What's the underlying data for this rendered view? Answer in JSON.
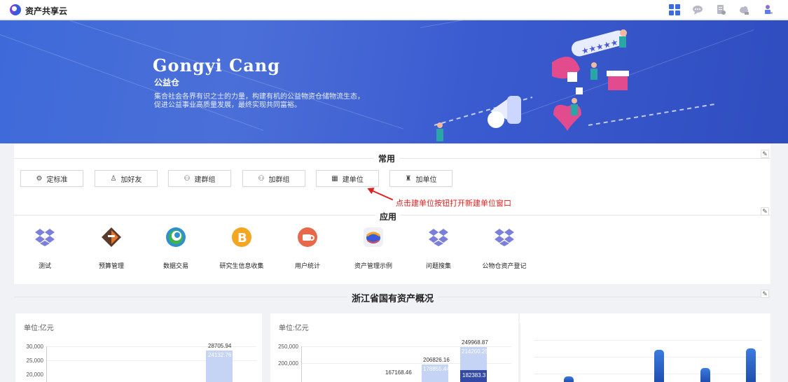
{
  "app": {
    "title": "资产共享云"
  },
  "topbar": {
    "icons": [
      "apps-grid-icon",
      "chat-icon",
      "document-icon",
      "cloud-icon",
      "user-tree-icon"
    ]
  },
  "banner": {
    "title": "Gongyi Cang",
    "subtitle": "公益仓",
    "desc_line1": "集合社会各界有识之士的力量，构建有机的公益物资仓储物流生态，",
    "desc_line2": "促进公益事业高质量发展，最终实现共同富裕。"
  },
  "common": {
    "title": "常用",
    "buttons": [
      {
        "label": "定标准",
        "icon": "gear-icon",
        "glyph": "⚙"
      },
      {
        "label": "加好友",
        "icon": "user-icon",
        "glyph": "♙"
      },
      {
        "label": "建群组",
        "icon": "group-icon",
        "glyph": "⚇"
      },
      {
        "label": "加群组",
        "icon": "group-add-icon",
        "glyph": "⚇"
      },
      {
        "label": "建单位",
        "icon": "building-icon",
        "glyph": "▦"
      },
      {
        "label": "加单位",
        "icon": "org-icon",
        "glyph": "♜"
      }
    ],
    "annotation": "点击建单位按钮打开新建单位窗口"
  },
  "apps": {
    "title": "应用",
    "items": [
      {
        "label": "测试",
        "icon": "dropbox-icon"
      },
      {
        "label": "预算管理",
        "icon": "budget-icon"
      },
      {
        "label": "数据交易",
        "icon": "swirl-icon"
      },
      {
        "label": "研究生信息收集",
        "icon": "bitcoin-icon"
      },
      {
        "label": "用户统计",
        "icon": "coffee-icon"
      },
      {
        "label": "资产管理示例",
        "icon": "asset-icon"
      },
      {
        "label": "问题搜集",
        "icon": "dropbox-icon"
      },
      {
        "label": "公物仓资产登记",
        "icon": "dropbox-icon"
      }
    ]
  },
  "overview": {
    "title": "浙江省国有资产概况",
    "unit1": "单位:亿元",
    "unit2": "单位:亿元",
    "chart1_ticks": [
      "30,000",
      "25,000",
      "20,000"
    ],
    "chart1_label_top": "28705.94",
    "chart1_label_inner": "24132.76",
    "chart2_ticks": [
      "250,000",
      "200,000"
    ],
    "chart2_labels": [
      "167168.46",
      "206826.16",
      "249968.87"
    ],
    "chart2_inner": [
      "178855.44",
      "214260.25"
    ],
    "chart2_dark_label": "182383.3"
  },
  "colors": {
    "accent": "#3b6be0",
    "annotation": "#e02020",
    "bar_light": "#c5d3f4",
    "bar_dark": "#3349a6"
  },
  "chart_data": [
    {
      "type": "bar",
      "ylabel": "单位:亿元",
      "ylim": [
        20000,
        30000
      ],
      "series": [
        {
          "values": [
            28705.94
          ]
        },
        {
          "values": [
            24132.76
          ]
        }
      ]
    },
    {
      "type": "bar",
      "ylabel": "单位:亿元",
      "ylim": [
        200000,
        250000
      ],
      "series": [
        {
          "values": [
            167168.46,
            206826.16,
            249968.87
          ]
        },
        {
          "values": [
            178855.44,
            214260.25
          ]
        },
        {
          "values": [
            182383.3
          ]
        }
      ]
    }
  ]
}
